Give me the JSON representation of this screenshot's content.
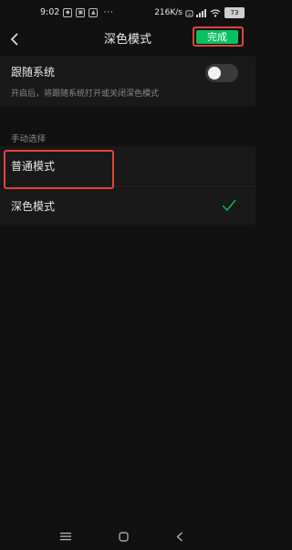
{
  "status_bar": {
    "time": "9:02",
    "speed": "216K/s",
    "battery": "73",
    "more": "···"
  },
  "header": {
    "title": "深色模式",
    "done_label": "完成"
  },
  "follow_system": {
    "title": "跟随系统",
    "description": "开启后，将跟随系统打开或关闭深色模式",
    "enabled": false
  },
  "manual": {
    "section_label": "手动选择",
    "options": [
      {
        "label": "普通模式",
        "selected": false
      },
      {
        "label": "深色模式",
        "selected": true
      }
    ]
  },
  "colors": {
    "accent": "#07c160",
    "highlight": "#e0443e",
    "background": "#111111",
    "card": "#191919"
  },
  "icons": {
    "back": "chevron-left-icon",
    "check": "check-icon",
    "nav_menu": "menu-icon",
    "nav_home": "home-icon",
    "nav_back": "back-triangle-icon"
  }
}
